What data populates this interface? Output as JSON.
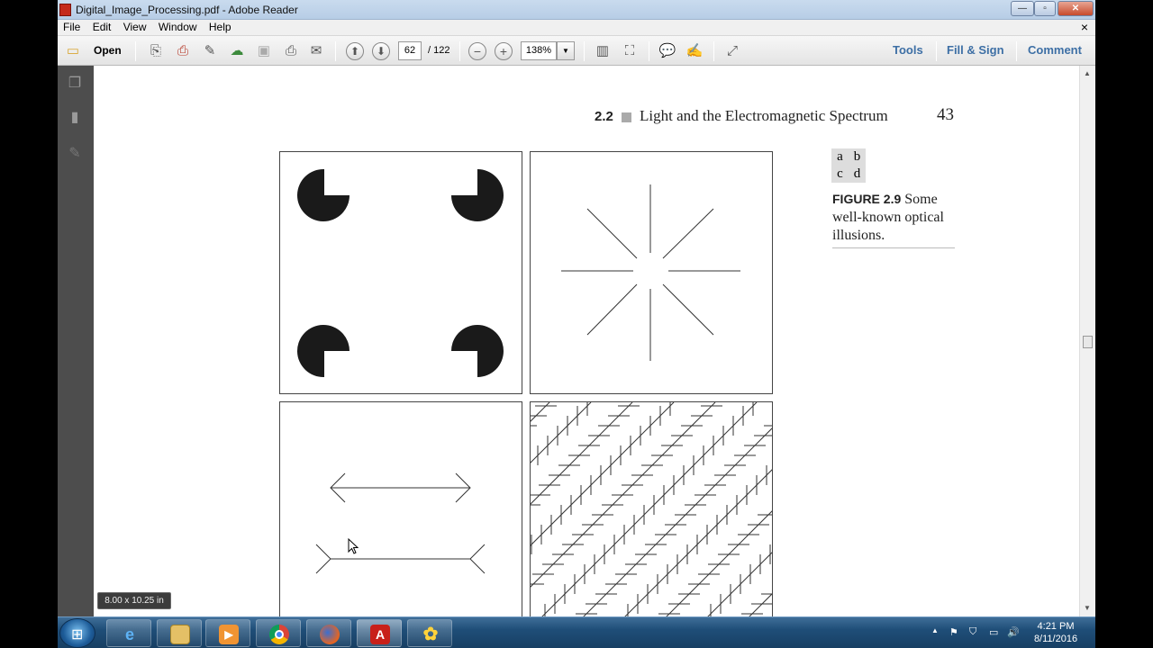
{
  "window": {
    "title": "Digital_Image_Processing.pdf - Adobe Reader",
    "controls": {
      "minimize": "—",
      "maximize": "▫",
      "close": "✕"
    },
    "doc_close": "×"
  },
  "menu": [
    "File",
    "Edit",
    "View",
    "Window",
    "Help"
  ],
  "toolbar": {
    "open_label": "Open",
    "page_current": "62",
    "page_total": "/ 122",
    "zoom": "138%",
    "tools_label": "Tools",
    "fill_sign_label": "Fill & Sign",
    "comment_label": "Comment"
  },
  "page": {
    "section_number": "2.2",
    "section_title": "Light and the Electromagnetic Spectrum",
    "page_number": "43",
    "panel_letters": [
      "a",
      "b",
      "c",
      "d"
    ],
    "figure_label": "FIGURE 2.9",
    "figure_caption": "Some well-known optical illusions."
  },
  "size_tooltip": "8.00 x 10.25 in",
  "taskbar": {
    "time": "4:21 PM",
    "date": "8/11/2016"
  }
}
